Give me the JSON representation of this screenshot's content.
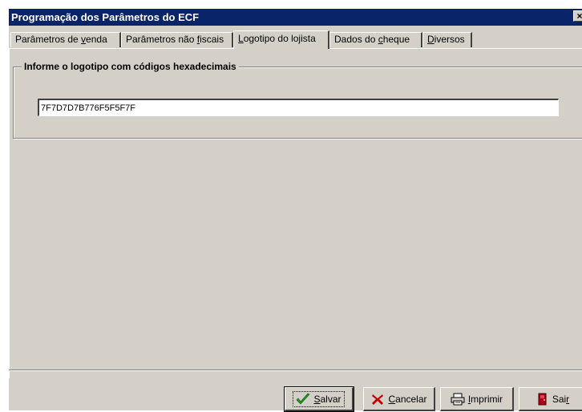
{
  "window": {
    "title": "Programação dos Parâmetros do ECF",
    "close_label": "×"
  },
  "tabs": [
    {
      "label_pre": "Parâmetros de ",
      "hotkey": "v",
      "label_post": "enda"
    },
    {
      "label_pre": "Parâmetros não ",
      "hotkey": "f",
      "label_post": "iscais"
    },
    {
      "label_pre": "",
      "hotkey": "L",
      "label_post": "ogotipo do lojista"
    },
    {
      "label_pre": "Dados do ",
      "hotkey": "c",
      "label_post": "heque"
    },
    {
      "label_pre": "",
      "hotkey": "D",
      "label_post": "iversos"
    }
  ],
  "active_tab": 2,
  "group": {
    "title": "Informe o logotipo com códigos hexadecimais"
  },
  "hex_input": {
    "value": "7F7D7D7B776F5F5F7F"
  },
  "buttons": {
    "save": {
      "hotkey": "S",
      "rest": "alvar"
    },
    "cancel": {
      "hotkey": "C",
      "rest": "ancelar"
    },
    "print": {
      "hotkey": "I",
      "rest": "mprimir"
    },
    "exit": {
      "pre": "Sai",
      "hotkey": "r"
    }
  },
  "icons": {
    "save": "checkmark-icon",
    "cancel": "x-mark-icon",
    "print": "printer-icon",
    "exit": "door-exit-icon"
  },
  "colors": {
    "titlebar": "#0a246a",
    "face": "#d4d0c8",
    "check": "#1e9a1e",
    "cancel": "#c00000",
    "exit": "#b00018"
  }
}
